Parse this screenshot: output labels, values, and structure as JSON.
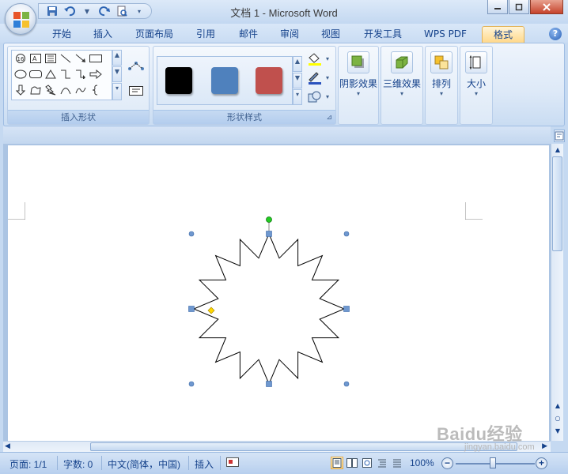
{
  "app": {
    "window_title": "文档 1 - Microsoft Word"
  },
  "tabs": [
    {
      "label": "开始"
    },
    {
      "label": "插入"
    },
    {
      "label": "页面布局"
    },
    {
      "label": "引用"
    },
    {
      "label": "邮件"
    },
    {
      "label": "审阅"
    },
    {
      "label": "视图"
    },
    {
      "label": "开发工具"
    },
    {
      "label": "WPS PDF"
    },
    {
      "label": "格式",
      "active": true
    }
  ],
  "ribbon": {
    "insert_shapes": {
      "label": "插入形状"
    },
    "shape_styles": {
      "label": "形状样式",
      "swatches": [
        "#111111",
        "#4f81bd",
        "#c0504d"
      ]
    },
    "shadow_effects": {
      "label": "阴影效果"
    },
    "3d_effects": {
      "label": "三维效果"
    },
    "arrange": {
      "label": "排列"
    },
    "size": {
      "label": "大小"
    }
  },
  "status": {
    "page": "页面: 1/1",
    "words": "字数: 0",
    "language": "中文(简体，中国)",
    "mode": "插入",
    "zoom": "100%"
  },
  "watermark": {
    "text": "Baidu经验",
    "sub": "jingyan.baidu.com"
  },
  "colors": {
    "accent": "#15428b",
    "handle": "#4f81bd",
    "rotate_handle": "#22cc22",
    "adjust_handle": "#ffd700"
  }
}
